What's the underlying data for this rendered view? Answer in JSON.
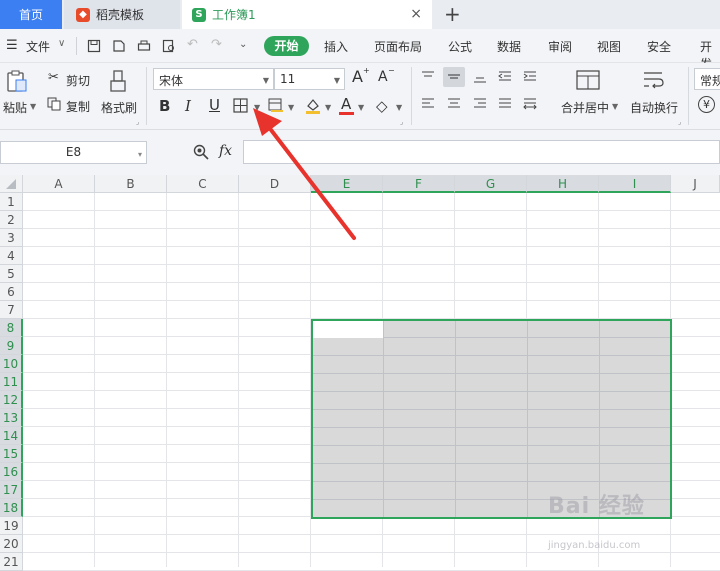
{
  "tabs": {
    "home": "首页",
    "template": "稻壳模板",
    "workbook": "工作簿1",
    "close": "×",
    "add": "+"
  },
  "menu": {
    "file": "文件",
    "start": "开始",
    "insert": "插入",
    "layout": "页面布局",
    "formula": "公式",
    "data": "数据",
    "review": "审阅",
    "view": "视图",
    "security": "安全",
    "dev": "开发"
  },
  "ribbon": {
    "paste": "粘贴",
    "cut": "剪切",
    "copy": "复制",
    "format_painter": "格式刷",
    "font_name": "宋体",
    "font_size": "11",
    "bold": "B",
    "italic": "I",
    "underline": "U",
    "merge_center": "合并居中",
    "wrap_text": "自动换行",
    "number_format": "常规",
    "currency_symbol": "¥",
    "grow_font": "A",
    "shrink_font": "A",
    "font_color": "A"
  },
  "formula_bar": {
    "name_box": "E8",
    "fx": "fx"
  },
  "grid": {
    "columns": [
      "A",
      "B",
      "C",
      "D",
      "E",
      "F",
      "G",
      "H",
      "I",
      "J"
    ],
    "rows": [
      "1",
      "2",
      "3",
      "4",
      "5",
      "6",
      "7",
      "8",
      "9",
      "10",
      "11",
      "12",
      "13",
      "14",
      "15",
      "16",
      "17",
      "18",
      "19",
      "20",
      "21"
    ],
    "selected_columns": [
      "E",
      "F",
      "G",
      "H",
      "I"
    ],
    "selected_rows": [
      "8",
      "9",
      "10",
      "11",
      "12",
      "13",
      "14",
      "15",
      "16",
      "17",
      "18"
    ],
    "selection_range": "E8:I18"
  },
  "watermark": {
    "brand": "Bai 经验",
    "url": "jingyan.baidu.com"
  },
  "colors": {
    "accent_green": "#2ea55a",
    "home_tab_blue": "#3b7ff2",
    "arrow_red": "#e8322c"
  }
}
